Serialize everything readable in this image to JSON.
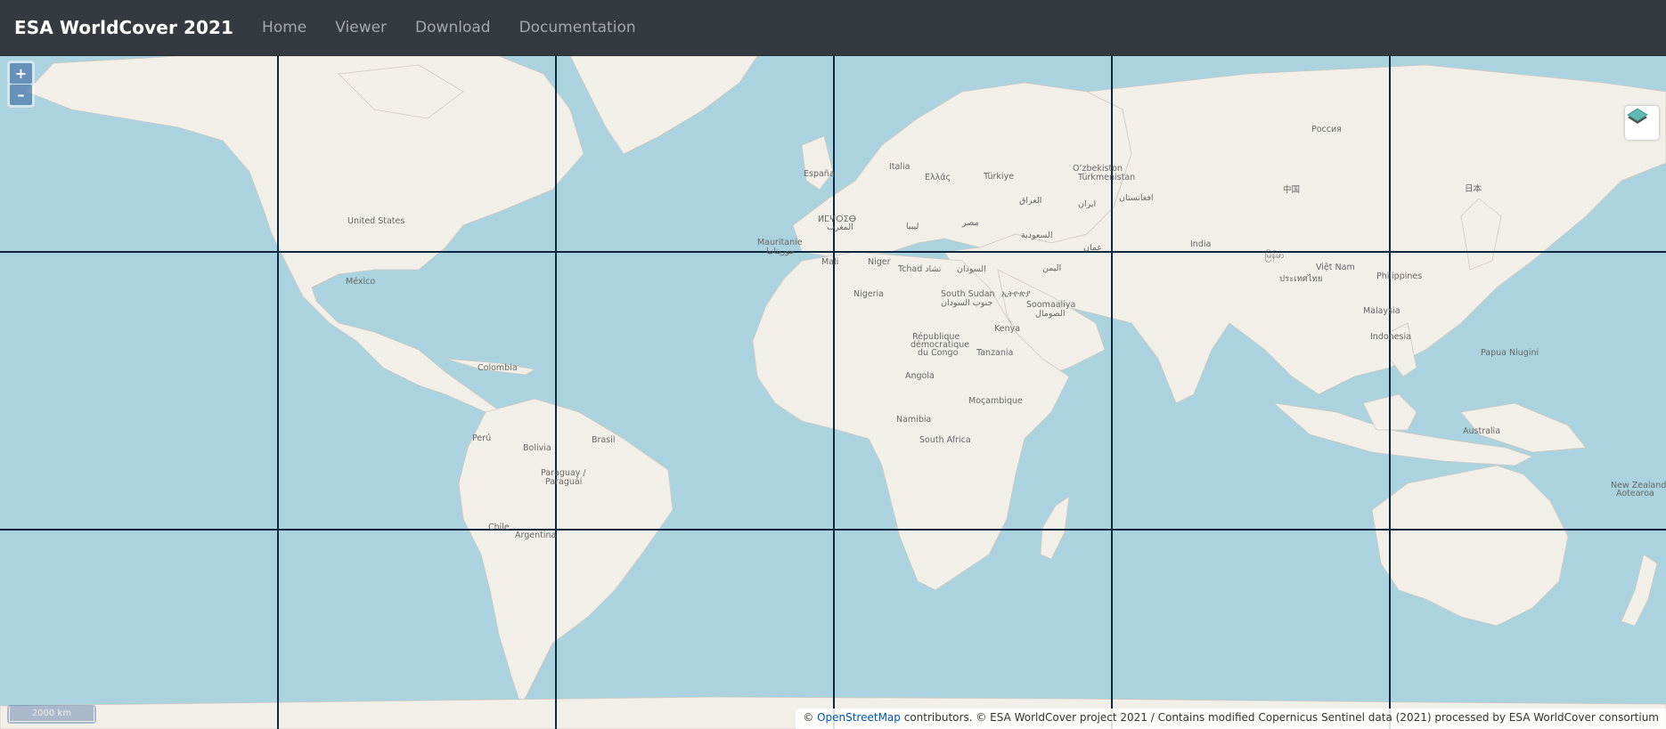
{
  "navbar": {
    "brand": "ESA WorldCover 2021",
    "links": [
      "Home",
      "Viewer",
      "Download",
      "Documentation"
    ]
  },
  "map": {
    "zoom_in": "+",
    "zoom_out": "–",
    "scale_label": "2000 km",
    "layer_switcher_icon": "layers-icon",
    "attribution": {
      "prefix": "© ",
      "osm_link": "OpenStreetMap",
      "text": " contributors. © ESA WorldCover project 2021 / Contains modified Copernicus Sentinel data (2021) processed by ESA WorldCover consortium"
    },
    "place_labels": [
      {
        "id": "us",
        "name": "United States"
      },
      {
        "id": "mx",
        "name": "México"
      },
      {
        "id": "co",
        "name": "Colombia"
      },
      {
        "id": "pe",
        "name": "Perú"
      },
      {
        "id": "bo",
        "name": "Bolivia"
      },
      {
        "id": "br",
        "name": "Brasil"
      },
      {
        "id": "py",
        "name": "Paraguay /"
      },
      {
        "id": "py2",
        "name": "Paraguái"
      },
      {
        "id": "cl",
        "name": "Chile"
      },
      {
        "id": "ar",
        "name": "Argentina"
      },
      {
        "id": "es",
        "name": "España"
      },
      {
        "id": "it",
        "name": "Italia"
      },
      {
        "id": "gr",
        "name": "Ελλάς"
      },
      {
        "id": "tr",
        "name": "Türkiye"
      },
      {
        "id": "uz",
        "name": "Oʻzbekiston"
      },
      {
        "id": "tm",
        "name": "Türkmenistan"
      },
      {
        "id": "af",
        "name": "افغانستان"
      },
      {
        "id": "iq",
        "name": "العراق"
      },
      {
        "id": "ir",
        "name": "ایران"
      },
      {
        "id": "ma",
        "name": "ⵍⵎⵖⵔⵉⴱ"
      },
      {
        "id": "ma2",
        "name": "المغرب"
      },
      {
        "id": "ly",
        "name": "ليبيا"
      },
      {
        "id": "eg",
        "name": "مصر"
      },
      {
        "id": "sa",
        "name": "السعودية"
      },
      {
        "id": "om",
        "name": "عمان"
      },
      {
        "id": "ye",
        "name": "اليمن"
      },
      {
        "id": "mr",
        "name": "Mauritanie"
      },
      {
        "id": "mr2",
        "name": "موريتانيا"
      },
      {
        "id": "ml",
        "name": "Mali"
      },
      {
        "id": "ne",
        "name": "Niger"
      },
      {
        "id": "td",
        "name": "Tchad تشاد"
      },
      {
        "id": "sd",
        "name": "السودان"
      },
      {
        "id": "ng",
        "name": "Nigeria"
      },
      {
        "id": "ss",
        "name": "South Sudan"
      },
      {
        "id": "ss2",
        "name": "جنوب السودان"
      },
      {
        "id": "et",
        "name": "ኢትዮጵያ"
      },
      {
        "id": "so",
        "name": "Soomaaliya"
      },
      {
        "id": "so2",
        "name": "الصومال"
      },
      {
        "id": "cd",
        "name": "République"
      },
      {
        "id": "cd2",
        "name": "démocratique"
      },
      {
        "id": "cd3",
        "name": "du Congo"
      },
      {
        "id": "ke",
        "name": "Kenya"
      },
      {
        "id": "tz",
        "name": "Tanzania"
      },
      {
        "id": "ao",
        "name": "Angola"
      },
      {
        "id": "mz",
        "name": "Moçambique"
      },
      {
        "id": "na",
        "name": "Namibia"
      },
      {
        "id": "za",
        "name": "South Africa"
      },
      {
        "id": "in",
        "name": "India"
      },
      {
        "id": "cn",
        "name": "中国"
      },
      {
        "id": "jp",
        "name": "日本"
      },
      {
        "id": "mm",
        "name": "မြန်မာ"
      },
      {
        "id": "th",
        "name": "ประเทศไทย"
      },
      {
        "id": "vn",
        "name": "Việt Nam"
      },
      {
        "id": "ph",
        "name": "Philippines"
      },
      {
        "id": "my",
        "name": "Malaysia"
      },
      {
        "id": "id",
        "name": "Indonesia"
      },
      {
        "id": "pg",
        "name": "Papua Niugini"
      },
      {
        "id": "au",
        "name": "Australia"
      },
      {
        "id": "nz",
        "name": "New Zealand /"
      },
      {
        "id": "nz2",
        "name": "Aotearoa"
      },
      {
        "id": "ru",
        "name": "Россия"
      }
    ]
  }
}
